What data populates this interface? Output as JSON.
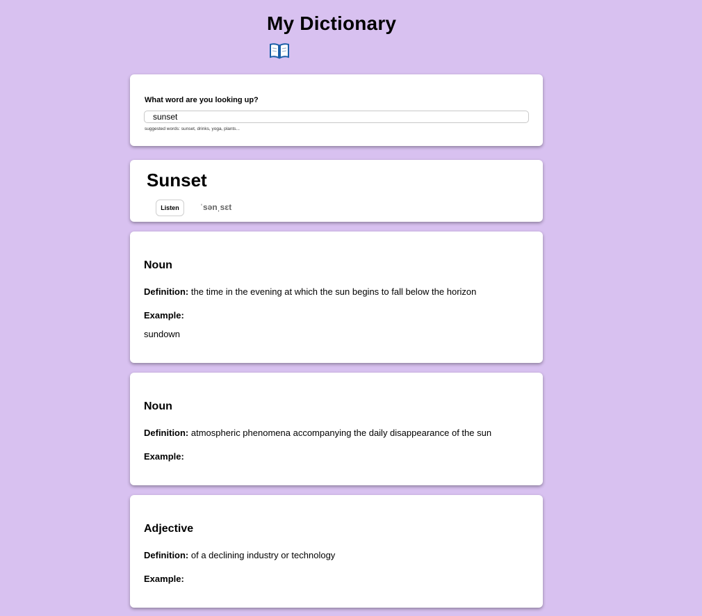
{
  "app": {
    "title": "My Dictionary",
    "icon": "open-book-icon"
  },
  "search": {
    "label": "What word are you looking up?",
    "value": "sunset",
    "hint": "suggested words: sunset, drinks, yoga, plants..."
  },
  "entry": {
    "word": "Sunset",
    "listen_label": "Listen",
    "phonetic": "ˈsənˌsɛt"
  },
  "meanings": [
    {
      "part_of_speech": "Noun",
      "definition_label": "Definition:",
      "definition": "the time in the evening at which the sun begins to fall below the horizon",
      "example_label": "Example:",
      "example": "sundown"
    },
    {
      "part_of_speech": "Noun",
      "definition_label": "Definition:",
      "definition": "atmospheric phenomena accompanying the daily disappearance of the sun",
      "example_label": "Example:",
      "example": ""
    },
    {
      "part_of_speech": "Adjective",
      "definition_label": "Definition:",
      "definition": "of a declining industry or technology",
      "example_label": "Example:",
      "example": ""
    }
  ],
  "colors": {
    "background": "#d8c1f0",
    "card": "#ffffff",
    "phonetic": "#666666"
  }
}
